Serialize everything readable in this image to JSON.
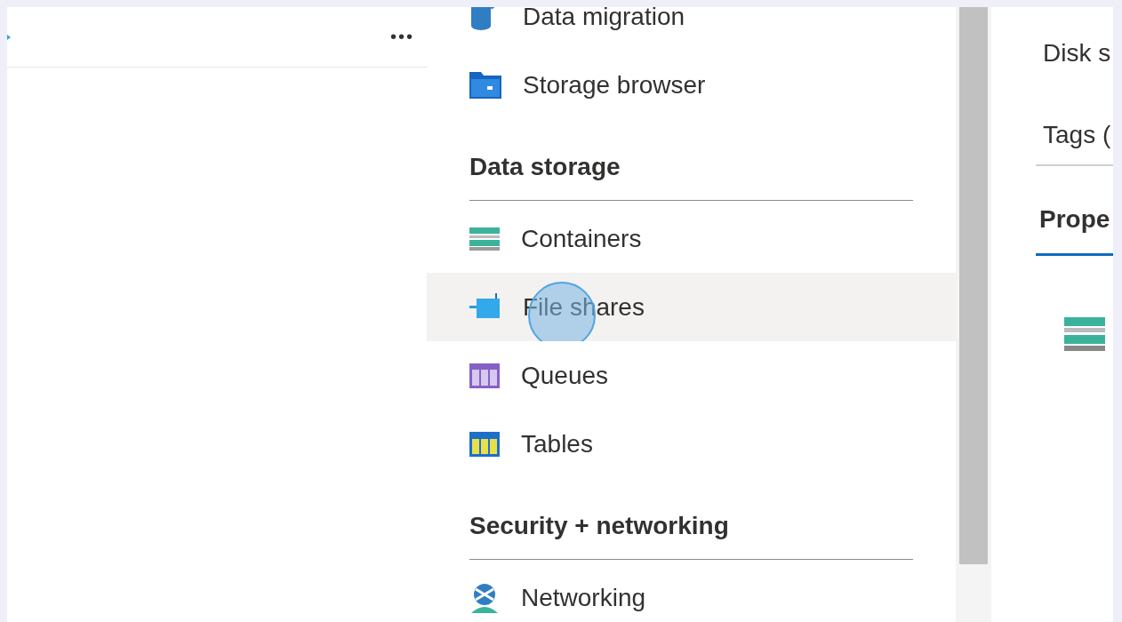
{
  "left_pane": {
    "more_button": "•••"
  },
  "menu": {
    "items": [
      {
        "label": "Data migration",
        "kind": "migration",
        "hovered": false
      },
      {
        "label": "Storage browser",
        "kind": "folder",
        "hovered": false
      }
    ],
    "sections": [
      {
        "title": "Data storage",
        "items": [
          {
            "label": "Containers",
            "kind": "containers",
            "hovered": false
          },
          {
            "label": "File shares",
            "kind": "fileshare",
            "hovered": true
          },
          {
            "label": "Queues",
            "kind": "queues",
            "hovered": false
          },
          {
            "label": "Tables",
            "kind": "tables",
            "hovered": false
          }
        ]
      },
      {
        "title": "Security + networking",
        "items": [
          {
            "label": "Networking",
            "kind": "networking",
            "hovered": false
          }
        ]
      }
    ]
  },
  "right_pane": {
    "fields": [
      "Disk s",
      "Tags ("
    ],
    "tab": {
      "label": "Prope",
      "selected": true
    }
  }
}
